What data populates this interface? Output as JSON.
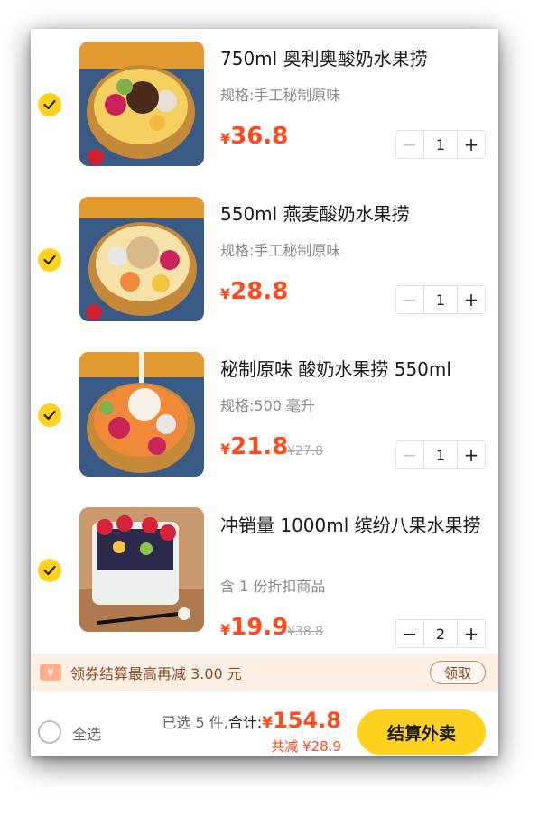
{
  "currency": "¥",
  "items": [
    {
      "title": "750ml 奥利奥酸奶水果捞",
      "spec": "规格:手工秘制原味",
      "price": "36.8",
      "original_price": "",
      "quantity": "1",
      "checked": true,
      "image_icon": "yogurt-fruit-bowl-image"
    },
    {
      "title": "550ml 燕麦酸奶水果捞",
      "spec": "规格:手工秘制原味",
      "price": "28.8",
      "original_price": "",
      "quantity": "1",
      "checked": true,
      "image_icon": "oat-yogurt-fruit-bowl-image"
    },
    {
      "title": "秘制原味 酸奶水果捞 550ml",
      "spec": "规格:500 毫升",
      "price": "21.8",
      "original_price": "¥27.8",
      "quantity": "1",
      "checked": true,
      "image_icon": "yogurt-pour-fruit-bowl-image"
    },
    {
      "title": "冲销量 1000ml 缤纷八果水果捞",
      "spec": "含 1 份折扣商品",
      "price": "19.9",
      "original_price": "¥38.8",
      "quantity": "2",
      "checked": true,
      "image_icon": "fruit-box-image"
    }
  ],
  "stepper": {
    "minus": "−",
    "plus": "+"
  },
  "coupon": {
    "icon_text": "¥",
    "text": "领券结算最高再减 3.00 元",
    "button": "领取"
  },
  "footer": {
    "select_all": "全选",
    "selected_count": "已选 5 件,",
    "total_label": "合计:",
    "total_yen": "¥",
    "total": "154.8",
    "saving": "共减 ¥28.9",
    "checkout": "结算外卖"
  },
  "colors": {
    "accent_yellow": "#ffd21f",
    "price_red": "#ff4a1c",
    "coupon_bg": "#fff0e6"
  }
}
